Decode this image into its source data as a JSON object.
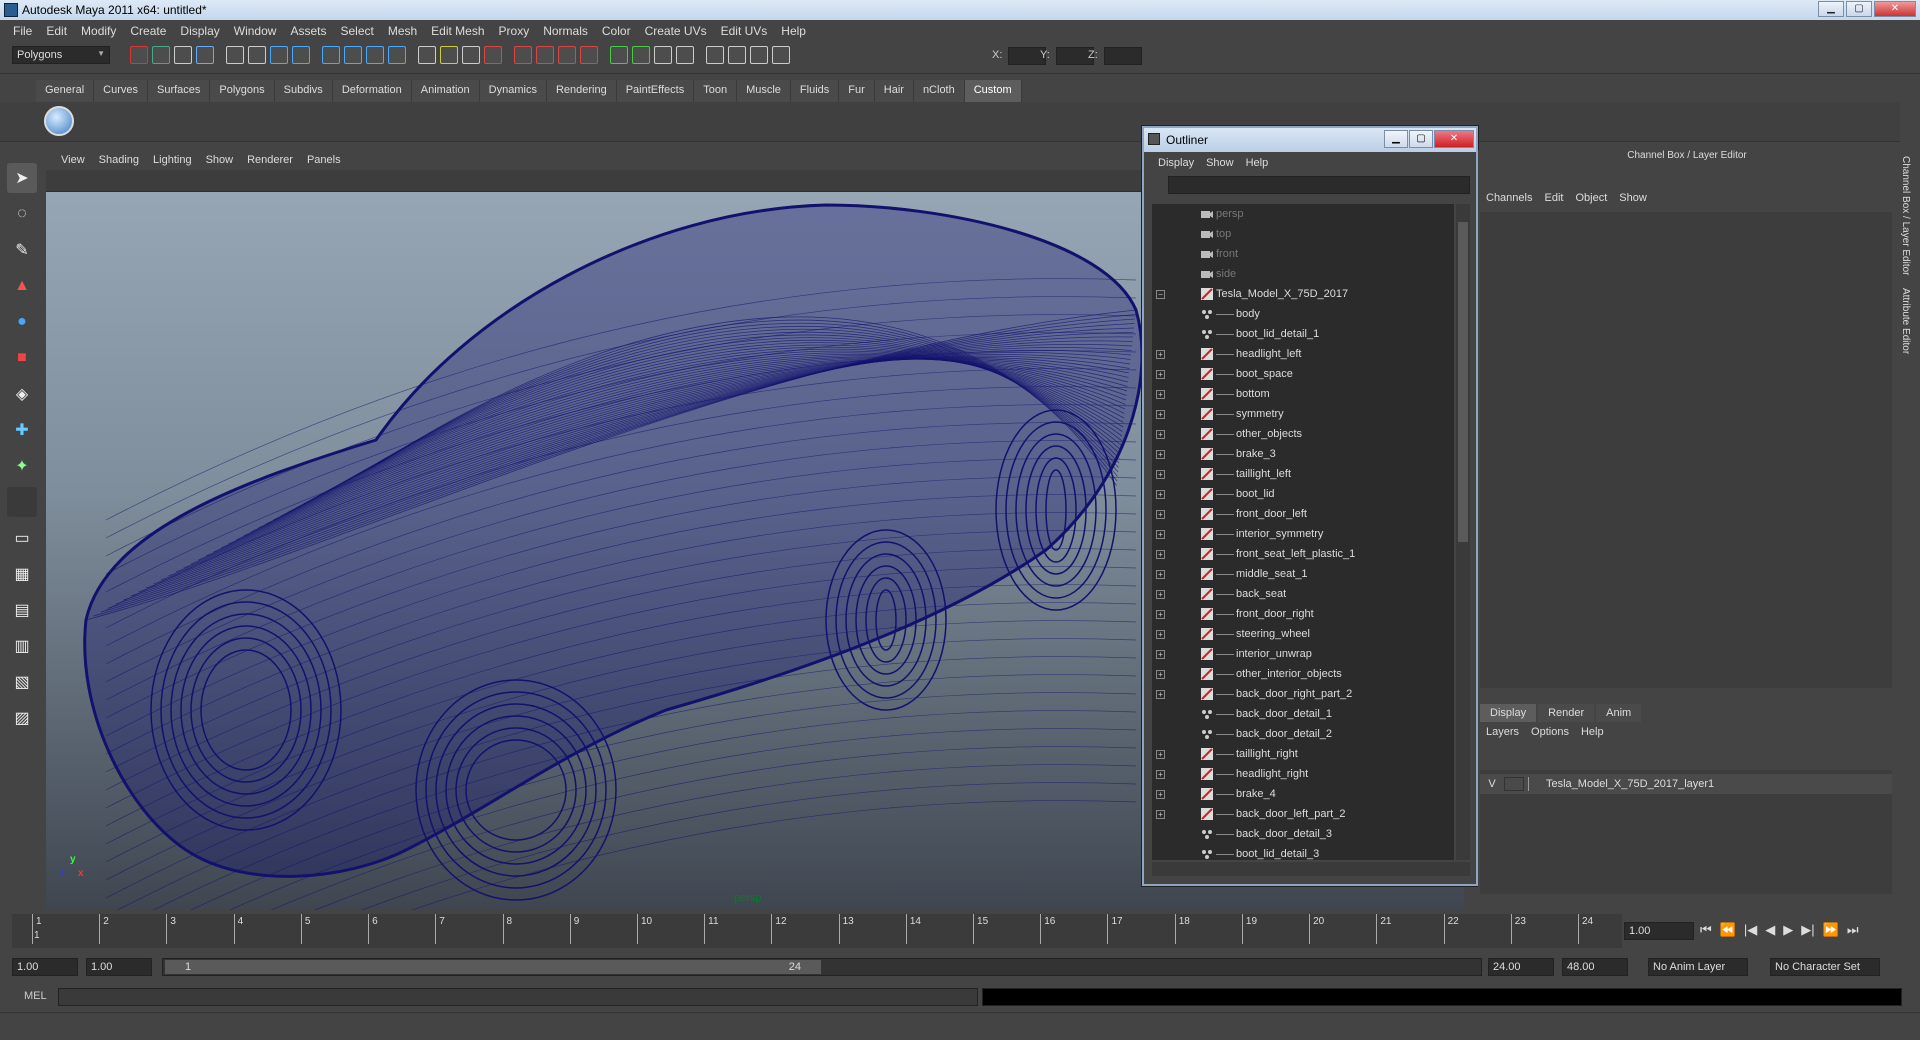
{
  "app": {
    "title": "Autodesk Maya 2011 x64: untitled*"
  },
  "menubar": [
    "File",
    "Edit",
    "Modify",
    "Create",
    "Display",
    "Window",
    "Assets",
    "Select",
    "Mesh",
    "Edit Mesh",
    "Proxy",
    "Normals",
    "Color",
    "Create UVs",
    "Edit UVs",
    "Help"
  ],
  "status": {
    "mode": "Polygons",
    "x_label": "X:",
    "y_label": "Y:",
    "z_label": "Z:"
  },
  "shelf": {
    "tabs": [
      "General",
      "Curves",
      "Surfaces",
      "Polygons",
      "Subdivs",
      "Deformation",
      "Animation",
      "Dynamics",
      "Rendering",
      "PaintEffects",
      "Toon",
      "Muscle",
      "Fluids",
      "Fur",
      "Hair",
      "nCloth",
      "Custom"
    ],
    "active": "Custom"
  },
  "viewport": {
    "menus": [
      "View",
      "Shading",
      "Lighting",
      "Show",
      "Renderer",
      "Panels"
    ],
    "camera": "persp",
    "axis_x": "x",
    "axis_y": "y",
    "axis_z": "z"
  },
  "outliner": {
    "title": "Outliner",
    "menus": [
      "Display",
      "Show",
      "Help"
    ],
    "cameras": [
      "persp",
      "top",
      "front",
      "side"
    ],
    "root": "Tesla_Model_X_75D_2017",
    "children": [
      {
        "name": "body",
        "exp": false,
        "mesh": true
      },
      {
        "name": "boot_lid_detail_1",
        "exp": false,
        "mesh": true
      },
      {
        "name": "headlight_left",
        "exp": true,
        "mesh": false
      },
      {
        "name": "boot_space",
        "exp": true,
        "mesh": false
      },
      {
        "name": "bottom",
        "exp": true,
        "mesh": false
      },
      {
        "name": "symmetry",
        "exp": true,
        "mesh": false
      },
      {
        "name": "other_objects",
        "exp": true,
        "mesh": false
      },
      {
        "name": "brake_3",
        "exp": true,
        "mesh": false
      },
      {
        "name": "taillight_left",
        "exp": true,
        "mesh": false
      },
      {
        "name": "boot_lid",
        "exp": true,
        "mesh": false
      },
      {
        "name": "front_door_left",
        "exp": true,
        "mesh": false
      },
      {
        "name": "interior_symmetry",
        "exp": true,
        "mesh": false
      },
      {
        "name": "front_seat_left_plastic_1",
        "exp": true,
        "mesh": false
      },
      {
        "name": "middle_seat_1",
        "exp": true,
        "mesh": false
      },
      {
        "name": "back_seat",
        "exp": true,
        "mesh": false
      },
      {
        "name": "front_door_right",
        "exp": true,
        "mesh": false
      },
      {
        "name": "steering_wheel",
        "exp": true,
        "mesh": false
      },
      {
        "name": "interior_unwrap",
        "exp": true,
        "mesh": false
      },
      {
        "name": "other_interior_objects",
        "exp": true,
        "mesh": false
      },
      {
        "name": "back_door_right_part_2",
        "exp": true,
        "mesh": false
      },
      {
        "name": "back_door_detail_1",
        "exp": false,
        "mesh": true
      },
      {
        "name": "back_door_detail_2",
        "exp": false,
        "mesh": true
      },
      {
        "name": "taillight_right",
        "exp": true,
        "mesh": false
      },
      {
        "name": "headlight_right",
        "exp": true,
        "mesh": false
      },
      {
        "name": "brake_4",
        "exp": true,
        "mesh": false
      },
      {
        "name": "back_door_left_part_2",
        "exp": true,
        "mesh": false
      },
      {
        "name": "back_door_detail_3",
        "exp": false,
        "mesh": true
      },
      {
        "name": "boot_lid_detail_3",
        "exp": false,
        "mesh": true
      }
    ]
  },
  "channelbox": {
    "title": "Channel Box / Layer Editor",
    "menus": [
      "Channels",
      "Edit",
      "Object",
      "Show"
    ],
    "side_tabs": [
      "Channel Box / Layer Editor",
      "Attribute Editor"
    ]
  },
  "layers": {
    "tabs": [
      "Display",
      "Render",
      "Anim"
    ],
    "active": "Display",
    "menus": [
      "Layers",
      "Options",
      "Help"
    ],
    "visible_flag": "V",
    "layer_name": "Tesla_Model_X_75D_2017_layer1"
  },
  "timeline": {
    "ticks": [
      "1",
      "2",
      "3",
      "4",
      "5",
      "6",
      "7",
      "8",
      "9",
      "10",
      "11",
      "12",
      "13",
      "14",
      "15",
      "16",
      "17",
      "18",
      "19",
      "20",
      "21",
      "22",
      "23",
      "24"
    ],
    "start_marker": "1",
    "current_frame": "1.00"
  },
  "range": {
    "start": "1.00",
    "playback_start": "1.00",
    "slider_start": "1",
    "slider_end": "24",
    "playback_end": "24.00",
    "end": "48.00",
    "anim_layer": "No Anim Layer",
    "char_set": "No Character Set"
  },
  "command": {
    "label": "MEL"
  },
  "colors": {
    "wire": "#12126e",
    "bg_top": "#9aa9b7",
    "bg_bottom": "#3f4650"
  }
}
